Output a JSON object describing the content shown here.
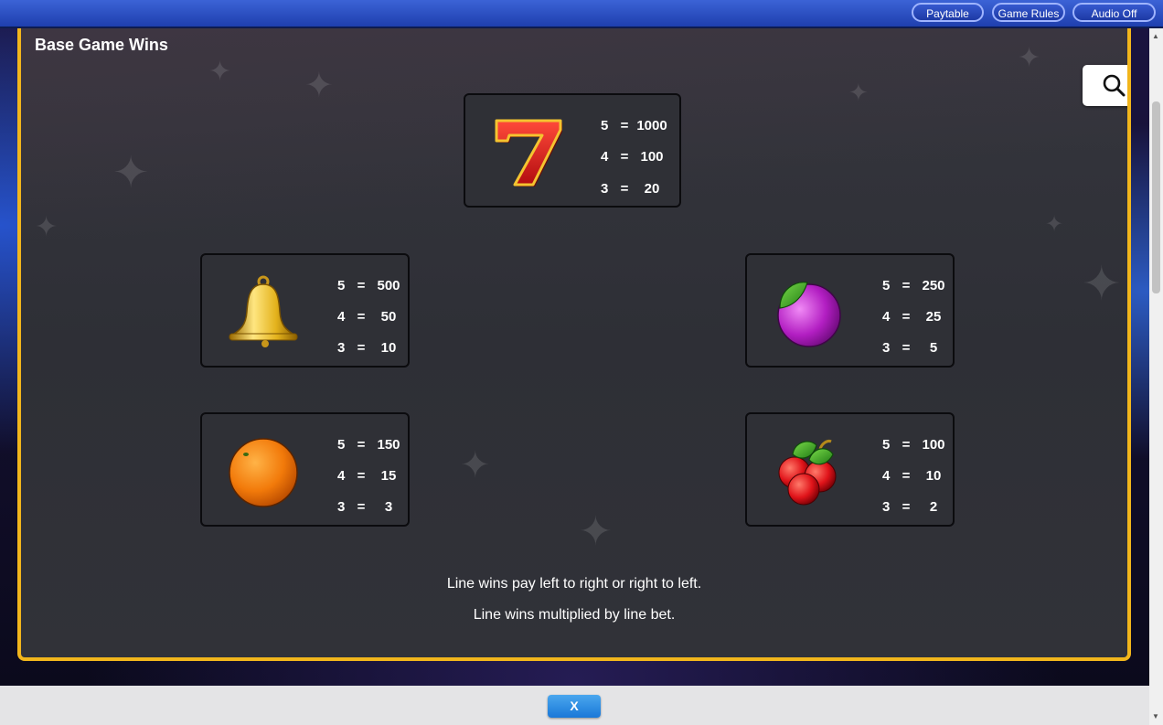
{
  "toolbar": {
    "paytable_label": "Paytable",
    "game_rules_label": "Game Rules",
    "audio_label": "Audio Off"
  },
  "panel": {
    "title": "Base Game Wins",
    "symbols": [
      {
        "icon": "seven-icon",
        "payouts": [
          {
            "count": "5",
            "eq": "=",
            "value": "1000"
          },
          {
            "count": "4",
            "eq": "=",
            "value": "100"
          },
          {
            "count": "3",
            "eq": "=",
            "value": "20"
          }
        ]
      },
      {
        "icon": "bell-icon",
        "payouts": [
          {
            "count": "5",
            "eq": "=",
            "value": "500"
          },
          {
            "count": "4",
            "eq": "=",
            "value": "50"
          },
          {
            "count": "3",
            "eq": "=",
            "value": "10"
          }
        ]
      },
      {
        "icon": "plum-icon",
        "payouts": [
          {
            "count": "5",
            "eq": "=",
            "value": "250"
          },
          {
            "count": "4",
            "eq": "=",
            "value": "25"
          },
          {
            "count": "3",
            "eq": "=",
            "value": "5"
          }
        ]
      },
      {
        "icon": "orange-icon",
        "payouts": [
          {
            "count": "5",
            "eq": "=",
            "value": "150"
          },
          {
            "count": "4",
            "eq": "=",
            "value": "15"
          },
          {
            "count": "3",
            "eq": "=",
            "value": "3"
          }
        ]
      },
      {
        "icon": "cherries-icon",
        "payouts": [
          {
            "count": "5",
            "eq": "=",
            "value": "100"
          },
          {
            "count": "4",
            "eq": "=",
            "value": "10"
          },
          {
            "count": "3",
            "eq": "=",
            "value": "2"
          }
        ]
      }
    ],
    "info_lines": [
      "Line wins pay left to right or right to left.",
      "Line wins multiplied by line bet."
    ]
  },
  "footer": {
    "close_label": "X"
  },
  "colors": {
    "accent_border": "#f2b61c",
    "topbar": "#2a4cc2",
    "close_button": "#2a8be0"
  }
}
